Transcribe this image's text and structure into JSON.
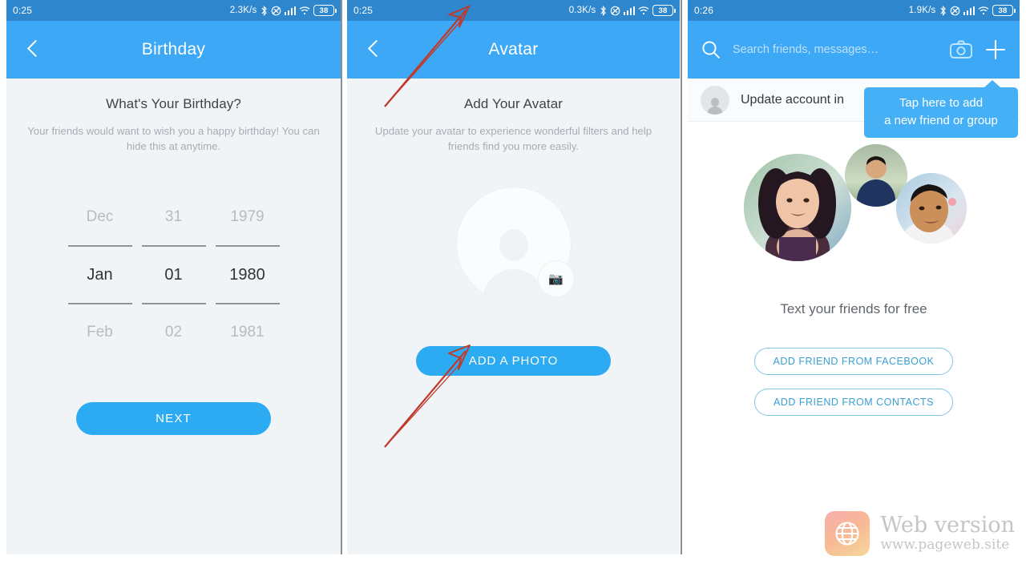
{
  "panels": [
    {
      "status": {
        "time": "0:25",
        "net_speed": "2.3K/s",
        "bluetooth_icon": "bluetooth-icon",
        "mute_icon": "vibrate-mute-icon",
        "signal_icon": "signal-bars-icon",
        "wifi_icon": "wifi-icon",
        "battery_level": "38"
      },
      "nav": {
        "back_icon": "chevron-left-icon",
        "title": "Birthday"
      },
      "heading": "What's Your Birthday?",
      "subtext": "Your friends would want to wish you a happy birthday! You can hide this at anytime.",
      "picker": {
        "month": {
          "prev": "Dec",
          "selected": "Jan",
          "next": "Feb"
        },
        "day": {
          "prev": "31",
          "selected": "01",
          "next": "02"
        },
        "year": {
          "prev": "1979",
          "selected": "1980",
          "next": "1981"
        }
      },
      "next_button": "NEXT"
    },
    {
      "status": {
        "time": "0:25",
        "net_speed": "0.3K/s",
        "bluetooth_icon": "bluetooth-icon",
        "mute_icon": "vibrate-mute-icon",
        "signal_icon": "signal-bars-icon",
        "wifi_icon": "wifi-icon",
        "battery_level": "38"
      },
      "nav": {
        "back_icon": "chevron-left-icon",
        "title": "Avatar"
      },
      "heading": "Add Your Avatar",
      "subtext": "Update your avatar to experience wonderful filters and help friends find you more easily.",
      "avatar_placeholder_icon": "person-placeholder-icon",
      "camera_badge_icon": "camera-icon",
      "add_photo_button": "ADD A PHOTO",
      "annotation_arrow": {
        "name": "red-arrow-annotation",
        "color": "#c0392b"
      }
    },
    {
      "status": {
        "time": "0:26",
        "net_speed": "1.9K/s",
        "bluetooth_icon": "bluetooth-icon",
        "mute_icon": "vibrate-mute-icon",
        "signal_icon": "signal-bars-icon",
        "wifi_icon": "wifi-icon",
        "battery_level": "38"
      },
      "search": {
        "search_icon": "search-icon",
        "placeholder": "Search friends, messages…",
        "camera_icon": "camera-icon",
        "add_icon": "plus-icon"
      },
      "account_row": {
        "avatar_icon": "person-placeholder-icon",
        "text": "Update account in"
      },
      "tooltip": {
        "line1": "Tap here to add",
        "line2": "a new friend or group"
      },
      "photos": [
        {
          "name": "friend-photo-1",
          "description": "woman smiling outdoors"
        },
        {
          "name": "friend-photo-2",
          "description": "man in blue shirt outdoors"
        },
        {
          "name": "friend-photo-3",
          "description": "man in white shirt"
        }
      ],
      "tagline": "Text your friends for free",
      "buttons": {
        "facebook": "ADD FRIEND FROM FACEBOOK",
        "contacts": "ADD FRIEND FROM CONTACTS"
      }
    }
  ],
  "watermark": {
    "logo_icon": "globe-icon",
    "title": "Web version",
    "url": "www.pageweb.site"
  },
  "colors": {
    "statusbar": "#2e86cc",
    "navbar": "#3da8f5",
    "primary_button": "#2cabf2",
    "tooltip": "#46b0f7",
    "panel_bg": "#f1f4f7",
    "outline_button_border": "#7ec4e8",
    "outline_button_text": "#3a9fd4",
    "annotation": "#c0392b"
  }
}
